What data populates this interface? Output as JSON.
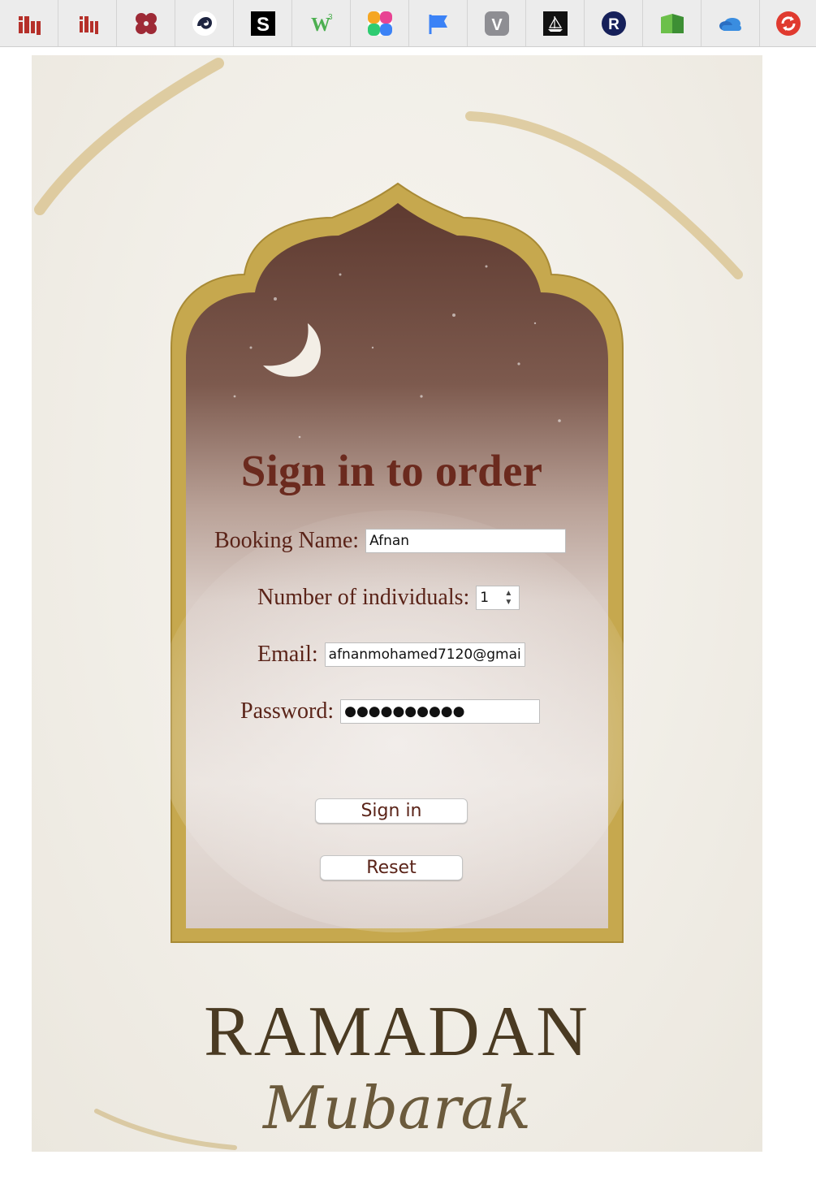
{
  "appbar": {
    "apps": [
      {
        "icon": "iti-logo-icon",
        "color": "#b5302a"
      },
      {
        "icon": "iti-logo-small-icon",
        "color": "#b5302a"
      },
      {
        "icon": "quatrefoil-logo-icon",
        "color": "#9e2a36"
      },
      {
        "icon": "swirl-logo-icon",
        "color": "#1d2440"
      },
      {
        "icon": "scribd-s-icon",
        "color": "#000000"
      },
      {
        "icon": "w3schools-icon",
        "color": "#4caf50"
      },
      {
        "icon": "color-wheel-icon",
        "color": "#f5a623"
      },
      {
        "icon": "flag-icon",
        "color": "#3b82f6"
      },
      {
        "icon": "v-badge-icon",
        "color": "#8e8e93"
      },
      {
        "icon": "ship-logo-icon",
        "color": "#111111"
      },
      {
        "icon": "r-circle-icon",
        "color": "#16205a"
      },
      {
        "icon": "green-book-icon",
        "color": "#4cae4c"
      },
      {
        "icon": "onedrive-cloud-icon",
        "color": "#3a8de0"
      },
      {
        "icon": "red-refresh-icon",
        "color": "#e03a2f"
      }
    ]
  },
  "form": {
    "title": "Sign in to order",
    "booking_name_label": "Booking Name:",
    "booking_name_value": "Afnan",
    "individuals_label": "Number of individuals:",
    "individuals_value": "1",
    "email_label": "Email:",
    "email_value": "afnanmohamed7120@gmai",
    "password_label": "Password:",
    "password_value": "●●●●●●●●●●",
    "sign_in_label": "Sign in",
    "reset_label": "Reset"
  },
  "banner": {
    "ramadan": "RAMADAN",
    "mubarak": "Mubarak"
  },
  "colors": {
    "title": "#6b2a1e",
    "label": "#5a2318",
    "gold": "#c9a94a",
    "arch_top": "#6e4a3e"
  }
}
